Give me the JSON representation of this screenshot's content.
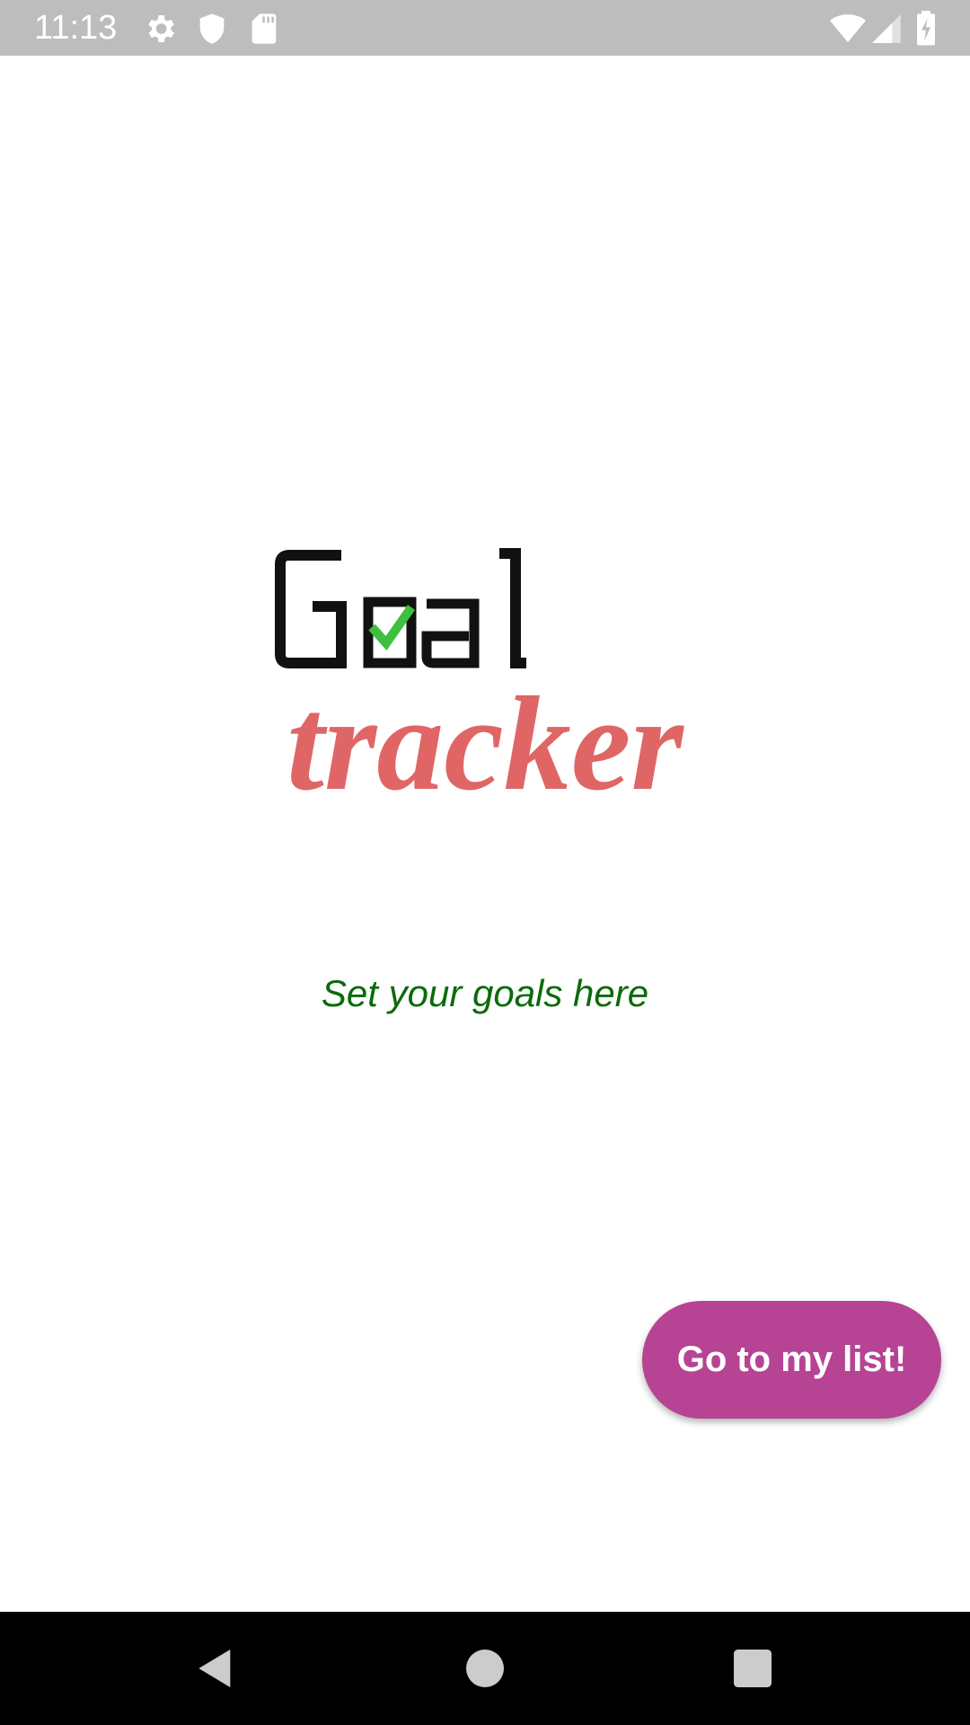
{
  "status_bar": {
    "time": "11:13",
    "left_icons": [
      "gear-icon",
      "shield-icon",
      "sd-card-icon"
    ],
    "right_icons": [
      "wifi-icon",
      "cell-signal-icon",
      "battery-charging-icon"
    ]
  },
  "logo": {
    "line1": "Goal",
    "line2": "tracker",
    "line1_color": "#111111",
    "line2_color": "#e06666",
    "check_color": "#3fbf3f"
  },
  "tagline": "Set your goals here",
  "tagline_color": "#0a6b0a",
  "fab": {
    "label": "Go to my list!",
    "color": "#b64394"
  },
  "nav_bar": {
    "buttons": [
      "back-icon",
      "home-icon",
      "recents-icon"
    ]
  }
}
